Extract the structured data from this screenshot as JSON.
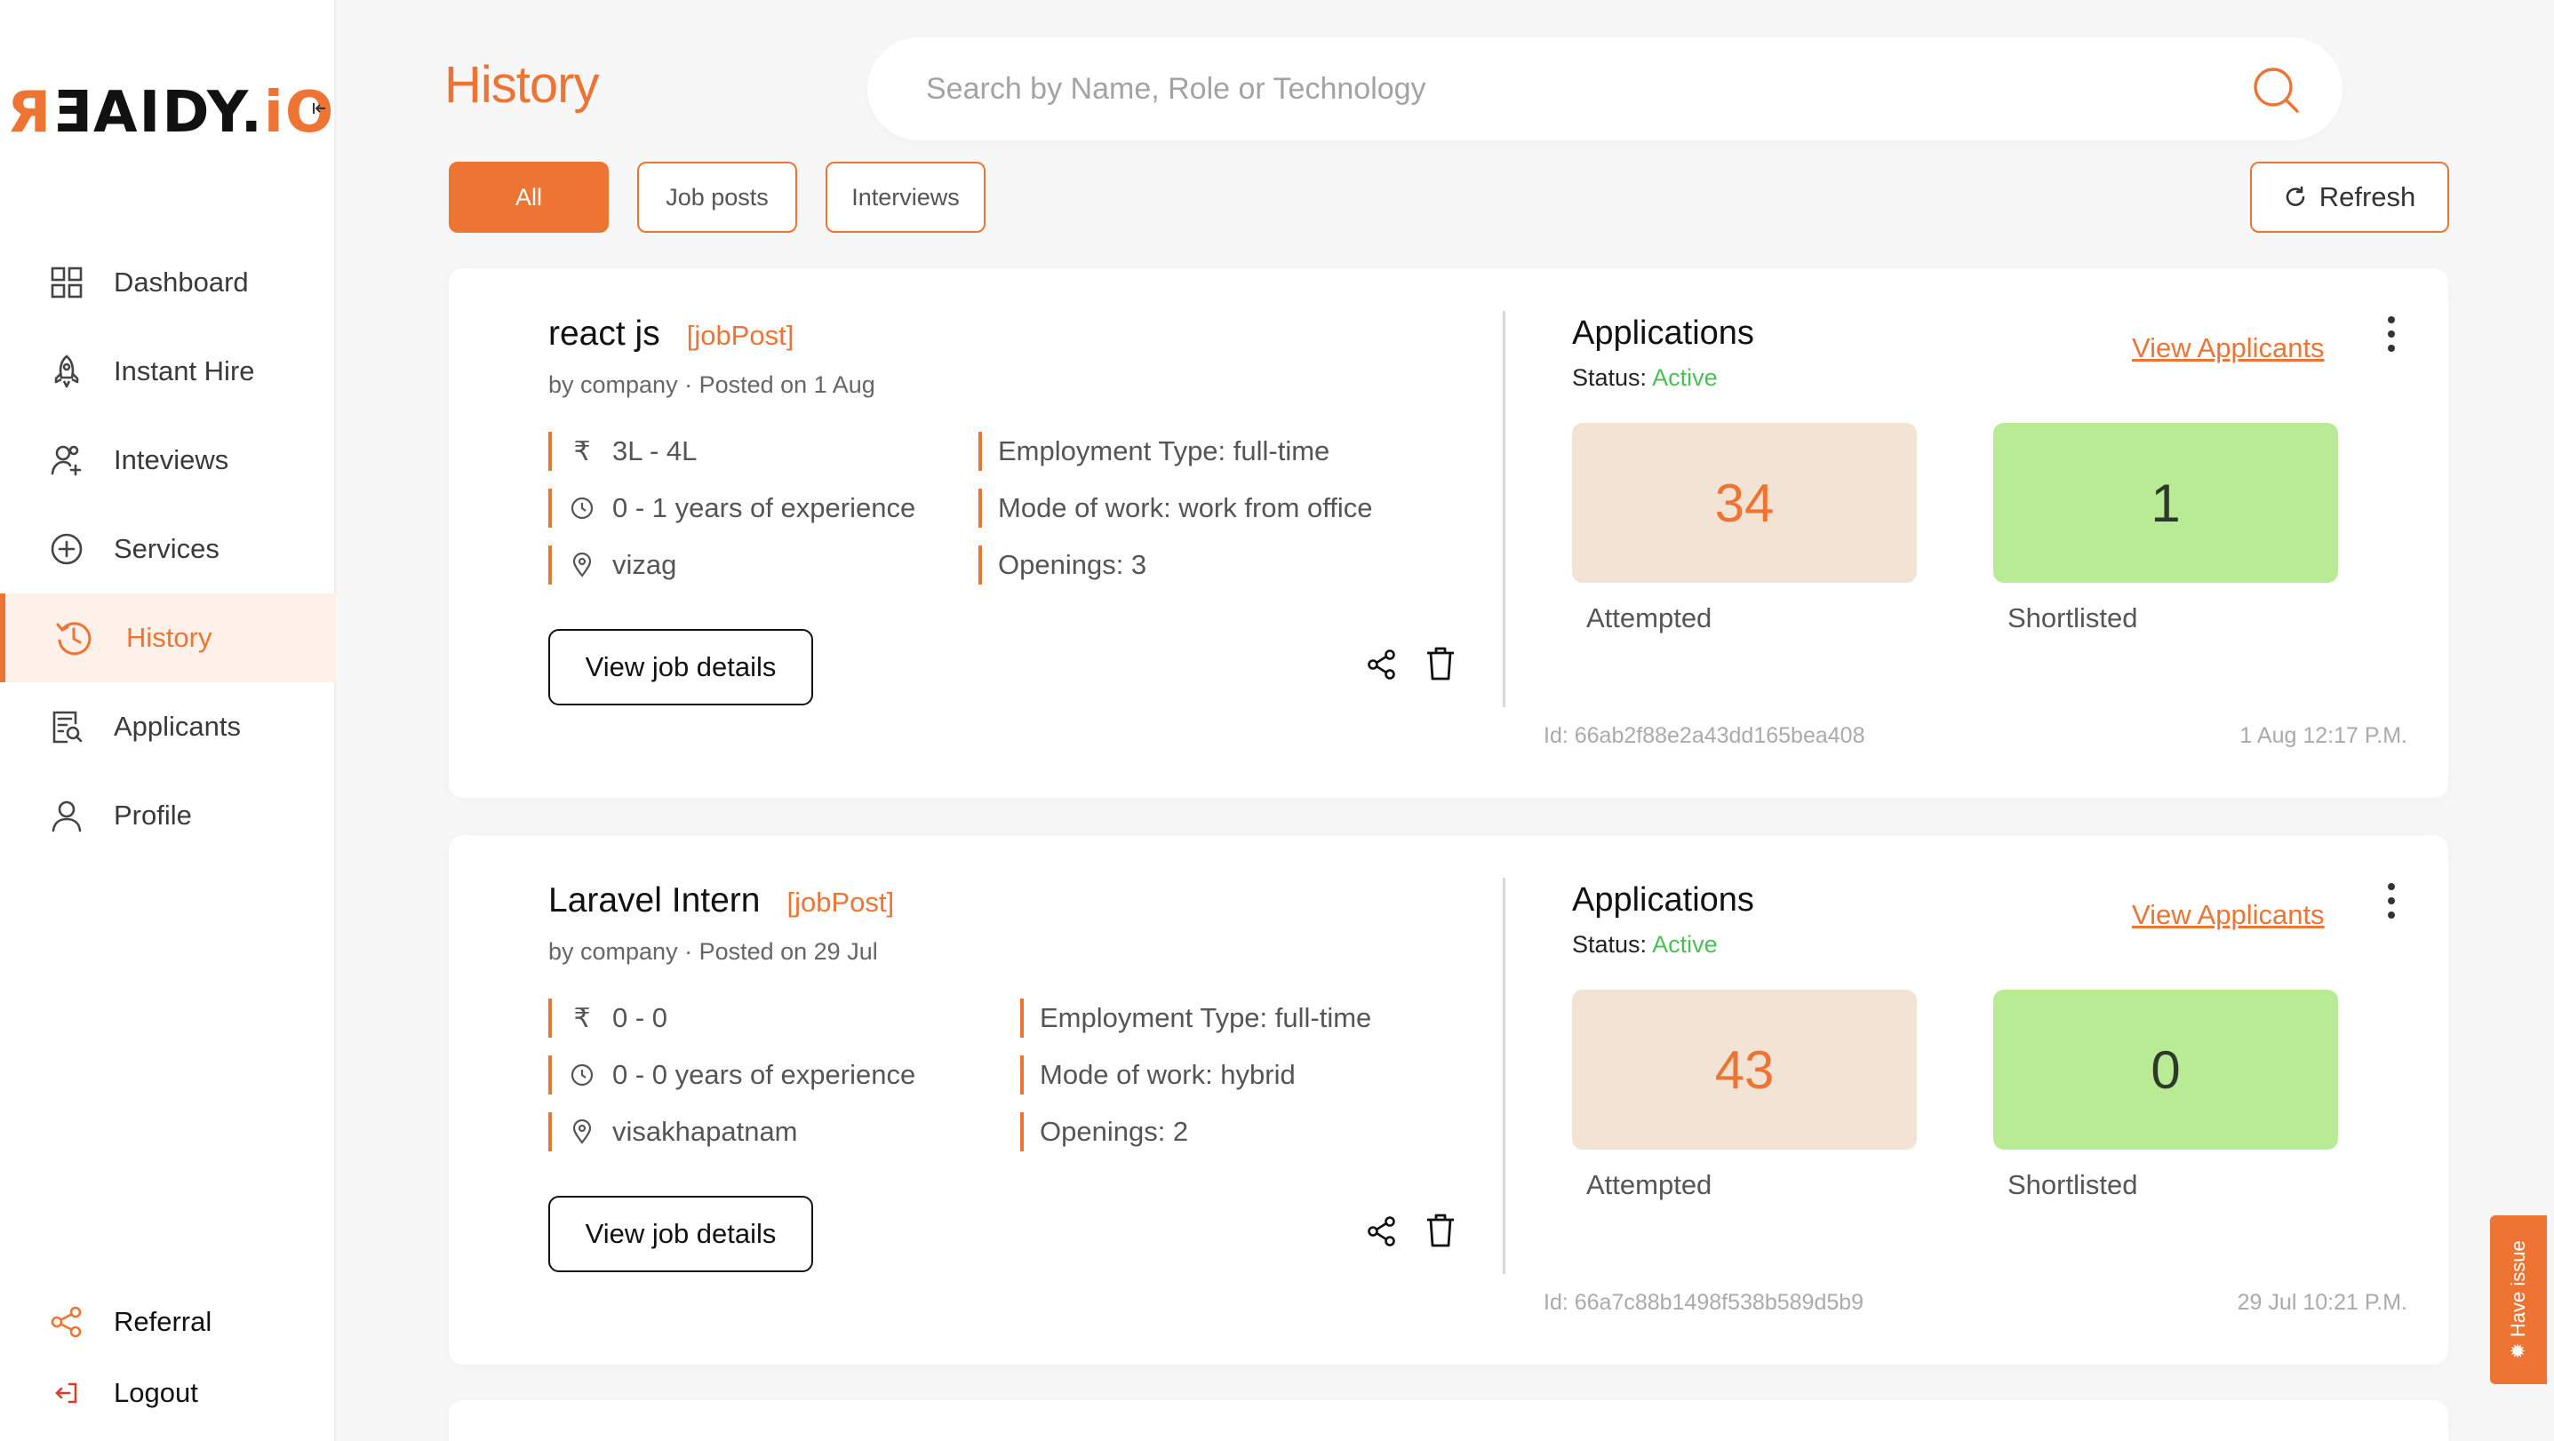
{
  "brand": {
    "logo_main": "ƎAIDY.",
    "logo_accent_r": "Я",
    "logo_accent": "iO",
    "collapse_icon": "collapse-left-icon",
    "accent_color": "#ee7433"
  },
  "sidebar": {
    "items": [
      {
        "label": "Dashboard",
        "icon": "grid-icon"
      },
      {
        "label": "Instant Hire",
        "icon": "rocket-icon"
      },
      {
        "label": "Inteviews",
        "icon": "users-icon"
      },
      {
        "label": "Services",
        "icon": "plus-circle-icon"
      },
      {
        "label": "History",
        "icon": "history-icon",
        "active": true
      },
      {
        "label": "Applicants",
        "icon": "document-search-icon"
      },
      {
        "label": "Profile",
        "icon": "user-icon"
      }
    ],
    "bottom": [
      {
        "label": "Referral",
        "icon": "share-icon"
      },
      {
        "label": "Logout",
        "icon": "logout-icon"
      }
    ]
  },
  "header": {
    "title": "History",
    "search_placeholder": "Search by Name, Role or Technology"
  },
  "filters": {
    "all": "All",
    "job_posts": "Job posts",
    "interviews": "Interviews",
    "refresh": "Refresh"
  },
  "cards": [
    {
      "title": "react js",
      "tag": "[jobPost]",
      "meta": "by company · Posted on 1 Aug",
      "salary": "3L - 4L",
      "experience": "0 - 1 years of experience",
      "location": "vizag",
      "employment_type": "Employment Type: full-time",
      "mode": "Mode of work: work from office",
      "openings": "Openings: 3",
      "view_details": "View job details",
      "apps_title": "Applications",
      "status_label": "Status:",
      "status_value": "Active",
      "view_applicants": "View Applicants",
      "attempted": "34",
      "attempted_label": "Attempted",
      "shortlisted": "1",
      "shortlisted_label": "Shortlisted",
      "id": "Id: 66ab2f88e2a43dd165bea408",
      "date": "1 Aug 12:17 P.M."
    },
    {
      "title": "Laravel Intern",
      "tag": "[jobPost]",
      "meta": "by company · Posted on 29 Jul",
      "salary": "0 - 0",
      "experience": "0 - 0 years of experience",
      "location": "visakhapatnam",
      "employment_type": "Employment Type: full-time",
      "mode": "Mode of work: hybrid",
      "openings": "Openings: 2",
      "view_details": "View job details",
      "apps_title": "Applications",
      "status_label": "Status:",
      "status_value": "Active",
      "view_applicants": "View Applicants",
      "attempted": "43",
      "attempted_label": "Attempted",
      "shortlisted": "0",
      "shortlisted_label": "Shortlisted",
      "id": "Id: 66a7c88b1498f538b589d5b9",
      "date": "29 Jul 10:21 P.M."
    }
  ],
  "issue_tab": {
    "label": "Have issue",
    "icon": "bug-icon"
  },
  "colors": {
    "accent": "#ee7433",
    "active_status": "#4bbf57",
    "attempted_bg": "#f3e3d5",
    "shortlisted_bg": "#b9eb94"
  }
}
